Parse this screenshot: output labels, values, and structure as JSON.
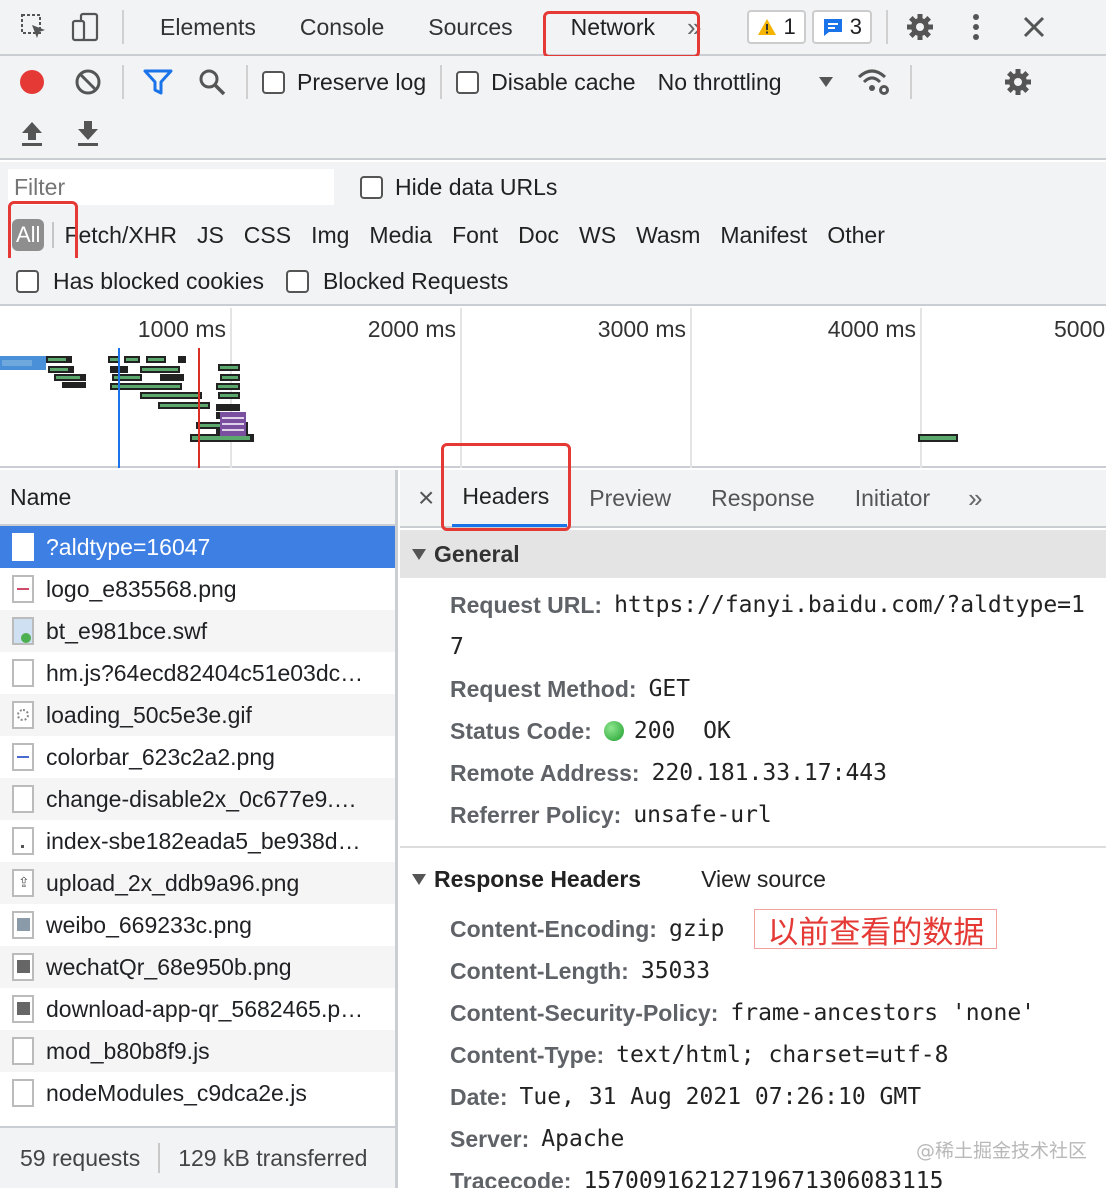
{
  "toolbar": {
    "tabs": [
      "Elements",
      "Console",
      "Sources",
      "Network"
    ],
    "more": "»",
    "warnings": "1",
    "messages": "3"
  },
  "network_toolbar": {
    "preserve_log": "Preserve log",
    "disable_cache": "Disable cache",
    "throttling": "No throttling"
  },
  "filter": {
    "placeholder": "Filter",
    "hide_data_urls": "Hide data URLs",
    "types": [
      "All",
      "Fetch/XHR",
      "JS",
      "CSS",
      "Img",
      "Media",
      "Font",
      "Doc",
      "WS",
      "Wasm",
      "Manifest",
      "Other"
    ],
    "has_blocked_cookies": "Has blocked cookies",
    "blocked_requests": "Blocked Requests"
  },
  "timeline": {
    "ticks": [
      "1000 ms",
      "2000 ms",
      "3000 ms",
      "4000 ms",
      "5000"
    ]
  },
  "list": {
    "header": "Name",
    "items": [
      "?aldtype=16047",
      "logo_e835568.png",
      "bt_e981bce.swf",
      "hm.js?64ecd82404c51e03dc…",
      "loading_50c5e3e.gif",
      "colorbar_623c2a2.png",
      "change-disable2x_0c677e9.…",
      "index-sbe182eada5_be938d…",
      "upload_2x_ddb9a96.png",
      "weibo_669233c.png",
      "wechatQr_68e950b.png",
      "download-app-qr_5682465.p…",
      "mod_b80b8f9.js",
      "nodeModules_c9dca2e.js"
    ],
    "requests": "59 requests",
    "transferred": "129 kB transferred"
  },
  "detail": {
    "close": "×",
    "tabs": [
      "Headers",
      "Preview",
      "Response",
      "Initiator"
    ],
    "more": "»",
    "general": {
      "title": "General",
      "request_url_key": "Request URL:",
      "request_url_val": "https://fanyi.baidu.com/?aldtype=1",
      "request_url_cont": "7",
      "method_key": "Request Method:",
      "method_val": "GET",
      "status_key": "Status Code:",
      "status_val": "200  OK",
      "remote_key": "Remote Address:",
      "remote_val": "220.181.33.17:443",
      "referrer_key": "Referrer Policy:",
      "referrer_val": "unsafe-url"
    },
    "response": {
      "title": "Response Headers",
      "view_source": "View source",
      "annotation": "以前查看的数据",
      "headers": [
        {
          "k": "Content-Encoding:",
          "v": "gzip"
        },
        {
          "k": "Content-Length:",
          "v": "35033"
        },
        {
          "k": "Content-Security-Policy:",
          "v": "frame-ancestors 'none'"
        },
        {
          "k": "Content-Type:",
          "v": "text/html; charset=utf-8"
        },
        {
          "k": "Date:",
          "v": "Tue, 31 Aug 2021 07:26:10 GMT"
        },
        {
          "k": "Server:",
          "v": "Apache"
        },
        {
          "k": "Tracecode:",
          "v": "15700916212719671306083115"
        }
      ]
    }
  },
  "watermark": "@稀土掘金技术社区",
  "colors": {
    "accent": "#1a73e8",
    "selected": "#3d7fe3",
    "highlight": "#e53935",
    "record": "#e53935"
  }
}
